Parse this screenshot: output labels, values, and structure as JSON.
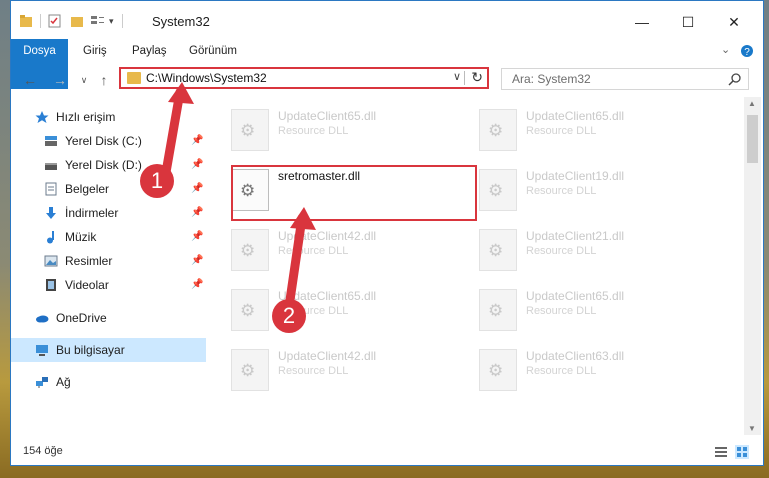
{
  "window": {
    "title": "System32",
    "controls": {
      "minimize": "—",
      "maximize": "☐",
      "close": "✕"
    }
  },
  "ribbon": {
    "tabs": [
      "Dosya",
      "Giriş",
      "Paylaş",
      "Görünüm"
    ],
    "expand_icon": "chevron-down-icon",
    "help_icon": "help-icon"
  },
  "navigation": {
    "back": "←",
    "forward": "→",
    "recent": "∨",
    "up": "↑"
  },
  "address": {
    "path": "C:\\Windows\\System32",
    "dropdown": "∨",
    "refresh": "↻"
  },
  "search": {
    "placeholder": "Ara: System32",
    "icon": "search-icon"
  },
  "sidebar": {
    "items": [
      {
        "label": "Hızlı erişim",
        "icon": "star-icon",
        "pinned": false
      },
      {
        "label": "Yerel Disk (C:)",
        "icon": "drive-icon",
        "pinned": true
      },
      {
        "label": "Yerel Disk (D:)",
        "icon": "drive-icon",
        "pinned": true
      },
      {
        "label": "Belgeler",
        "icon": "documents-icon",
        "pinned": true
      },
      {
        "label": "İndirmeler",
        "icon": "download-icon",
        "pinned": true
      },
      {
        "label": "Müzik",
        "icon": "music-icon",
        "pinned": true
      },
      {
        "label": "Resimler",
        "icon": "pictures-icon",
        "pinned": true
      },
      {
        "label": "Videolar",
        "icon": "video-icon",
        "pinned": true
      },
      {
        "label": "OneDrive",
        "icon": "cloud-icon",
        "pinned": false
      },
      {
        "label": "Bu bilgisayar",
        "icon": "computer-icon",
        "pinned": false,
        "selected": true
      },
      {
        "label": "Ağ",
        "icon": "network-icon",
        "pinned": false
      }
    ],
    "pin_glyph": "📌"
  },
  "files": [
    {
      "name": "UpdateClient65.dll",
      "desc": "Resource DLL"
    },
    {
      "name": "UpdateClient65.dll",
      "desc": "Resource DLL"
    },
    {
      "name": "sretromaster.dll",
      "desc": "",
      "focused": true
    },
    {
      "name": "UpdateClient19.dll",
      "desc": "Resource DLL"
    },
    {
      "name": "UpdateClient42.dll",
      "desc": "Resource DLL"
    },
    {
      "name": "UpdateClient21.dll",
      "desc": "Resource DLL"
    },
    {
      "name": "UpdateClient65.dll",
      "desc": "Resource DLL"
    },
    {
      "name": "UpdateClient65.dll",
      "desc": "Resource DLL"
    },
    {
      "name": "UpdateClient42.dll",
      "desc": "Resource DLL"
    },
    {
      "name": "UpdateClient63.dll",
      "desc": "Resource DLL"
    }
  ],
  "status": {
    "count": "154 öğe"
  },
  "annotations": {
    "step1": "1",
    "step2": "2",
    "color": "#d9353d"
  },
  "colors": {
    "accent": "#1979ca",
    "selection": "#cce8ff",
    "annotation": "#d9353d"
  }
}
